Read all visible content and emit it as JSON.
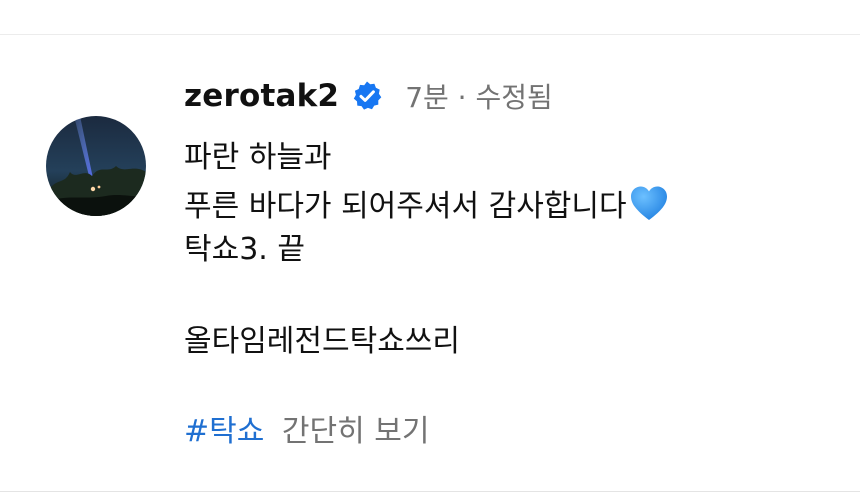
{
  "comment": {
    "username": "zerotak2",
    "verified": true,
    "time": "7분",
    "separator": "·",
    "edited": "수정됨",
    "lines": [
      "파란 하늘과",
      "푸른 바다가 되어주셔서 감사합니다",
      "탁쇼3. 끝",
      "올타임레전드탁쇼쓰리"
    ],
    "hashtag": "#탁쇼",
    "see_more": "간단히 보기"
  },
  "icons": {
    "verified": "verified-badge-icon",
    "heart": "blue-heart-emoji"
  },
  "colors": {
    "verified_badge": "#1877f2",
    "hashtag": "#1f6fd1",
    "heart": "#2f8fe8",
    "muted_text": "#737373"
  }
}
